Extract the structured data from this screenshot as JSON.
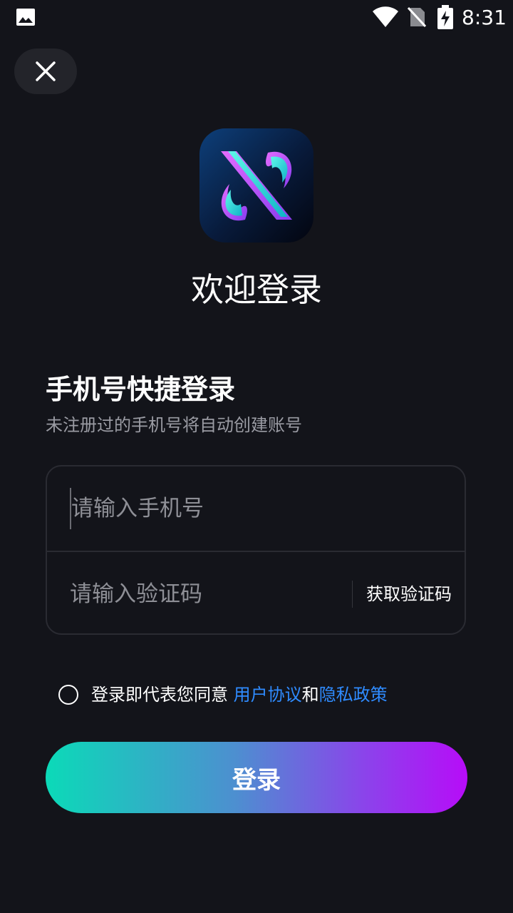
{
  "status_bar": {
    "time": "8:31",
    "icons": [
      "gallery-icon",
      "wifi-icon",
      "no-sim-icon",
      "battery-charging-icon"
    ]
  },
  "header": {
    "close_icon": "close-icon",
    "logo": "app-logo",
    "title": "欢迎登录"
  },
  "login": {
    "section_title": "手机号快捷登录",
    "section_subtitle": "未注册过的手机号将自动创建账号",
    "phone_placeholder": "请输入手机号",
    "phone_value": "",
    "code_placeholder": "请输入验证码",
    "code_value": "",
    "get_code_label": "获取验证码"
  },
  "agreement": {
    "checked": false,
    "text_prefix": "登录即代表您同意 ",
    "user_agreement": "用户协议",
    "conjunction": "和",
    "privacy_policy": "隐私政策"
  },
  "actions": {
    "login_label": "登录"
  },
  "colors": {
    "background": "#13141a",
    "link": "#2f8bff",
    "gradient_start": "#0bdab8",
    "gradient_end": "#b70cf8"
  }
}
